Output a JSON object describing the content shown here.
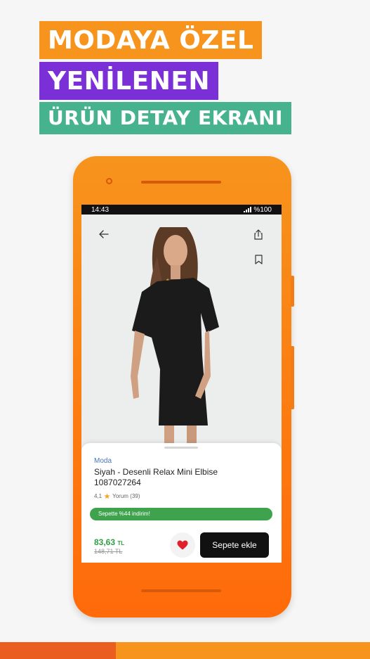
{
  "banners": {
    "line1": "MODAYA ÖZEL",
    "line2": "YENİLENEN",
    "line3": "ÜRÜN DETAY EKRANI",
    "line1_color": "#f7941d",
    "line2_color": "#7b2fd6",
    "line3_color": "#47b38e"
  },
  "status": {
    "time": "14:43",
    "battery": "%100"
  },
  "product": {
    "category": "Moda",
    "title": "Siyah - Desenli Relax Mini Elbise 1087027264",
    "rating": "4,1",
    "reviews": "Yorum (39)",
    "discount_text": "Sepette %44 indirim!",
    "price": "83,63",
    "currency": "TL",
    "old_price": "148,71 TL",
    "add_to_cart": "Sepete ekle"
  },
  "icons": {
    "back": "arrow-left-icon",
    "share": "share-icon",
    "bookmark": "bookmark-icon",
    "favorite": "heart-icon",
    "star": "star-icon"
  },
  "colors": {
    "accent": "#f7941d",
    "price_green": "#2f9e44",
    "discount_green": "#3fa34d",
    "heart_red": "#e0202a"
  }
}
